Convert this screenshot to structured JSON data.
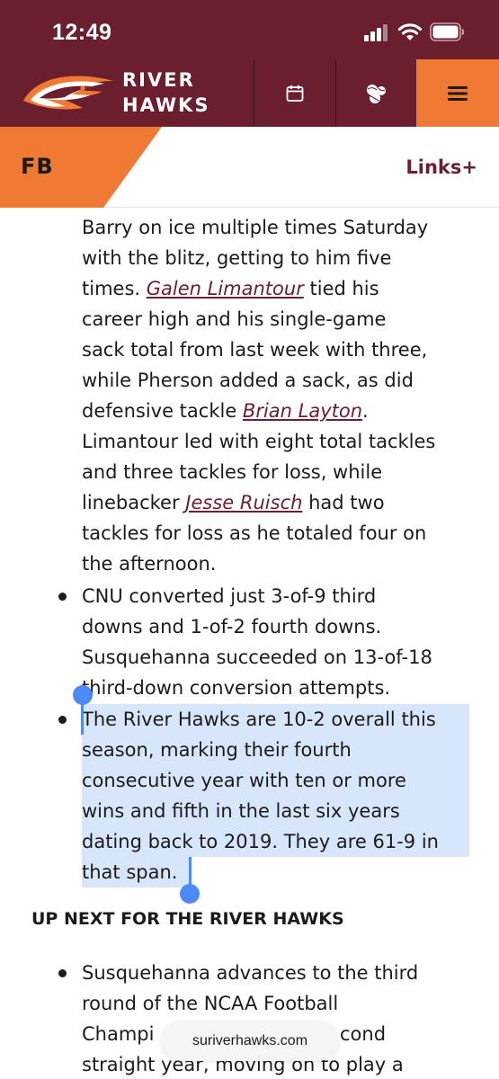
{
  "status_bar": {
    "time": "12:49"
  },
  "header": {
    "brand_line1": "RIVER",
    "brand_line2": "HAWKS",
    "icons": [
      "calendar-icon",
      "sports-balls-icon",
      "menu-icon"
    ],
    "accent_color": "#f07a33",
    "brand_color": "#6b1e2e"
  },
  "sport_bar": {
    "sport": "FB",
    "links_label": "Links+"
  },
  "article": {
    "p1": {
      "l1": "Barry on ice multiple times Saturday",
      "l2": "with the blitz, getting to him five",
      "l3_pre": "times. ",
      "l3_link": "Galen Limantour",
      "l3_post": " tied his",
      "l4": "career high and his single-game",
      "l5": "sack total from last week with three,",
      "l6": "while Pherson added a sack, as did",
      "l7_pre": "defensive tackle ",
      "l7_link": "Brian Layton",
      "l7_post": ".",
      "l8": "Limantour led with eight total tackles",
      "l9": "and three tackles for loss, while",
      "l10_pre": "linebacker ",
      "l10_link": "Jesse Ruisch",
      "l10_post": " had two",
      "l11": "tackles for loss as he totaled four on",
      "l12": "the afternoon."
    },
    "b2": {
      "l1": "CNU converted just 3-of-9 third",
      "l2": "downs and 1-of-2 fourth downs.",
      "l3": "Susquehanna succeeded on 13-of-18",
      "l4": "third-down conversion attempts."
    },
    "b3": {
      "l1": "The River Hawks are 10-2 overall this",
      "l2": "season, marking their fourth",
      "l3": "consecutive year with ten or more",
      "l4": "wins and fifth in the last six years",
      "l5": "dating back to 2019. They are 61-9 in",
      "l6": "that span."
    },
    "up_next_heading": "UP NEXT FOR THE RIVER HAWKS",
    "b4": {
      "l1": "Susquehanna advances to the third",
      "l2": "round of the NCAA Football",
      "l3_pre": "Champi",
      "l3_post": "cond",
      "l4": "straight year, moving on to play a"
    }
  },
  "browser": {
    "url": "suriverhawks.com"
  }
}
